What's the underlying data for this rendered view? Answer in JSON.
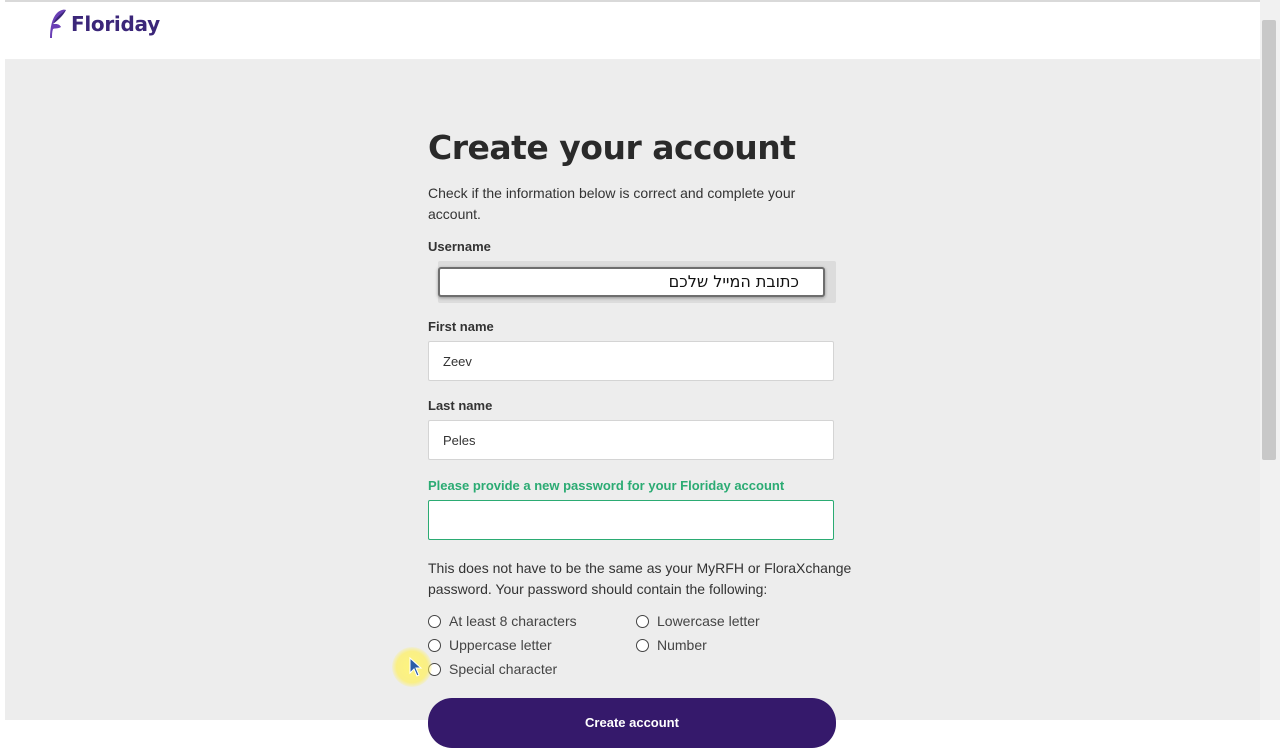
{
  "brand": {
    "name": "Floriday",
    "color": "#3b2679"
  },
  "form": {
    "title": "Create your account",
    "intro": "Check if the information below is correct and complete your account.",
    "username_label": "Username",
    "username_value": "כתובת המייל שלכם",
    "firstname_label": "First name",
    "firstname_value": "Zeev",
    "lastname_label": "Last name",
    "lastname_value": "Peles",
    "password_label": "Please provide a new password for your Floriday account",
    "password_value": "",
    "note_line1": "This does not have to be the same as your MyRFH or FloraXchange",
    "note_line2": "password. Your password should contain the following:",
    "requirements": [
      "At least 8 characters",
      "Lowercase letter",
      "Uppercase letter",
      "Number",
      "Special character"
    ],
    "submit_label": "Create account"
  },
  "colors": {
    "accent": "#2bab73",
    "button": "#35196b",
    "background": "#ededed"
  },
  "icons": {
    "logo": "floriday-leaf-icon",
    "requirement": "radio-empty-icon",
    "cursor": "mouse-pointer-icon"
  }
}
